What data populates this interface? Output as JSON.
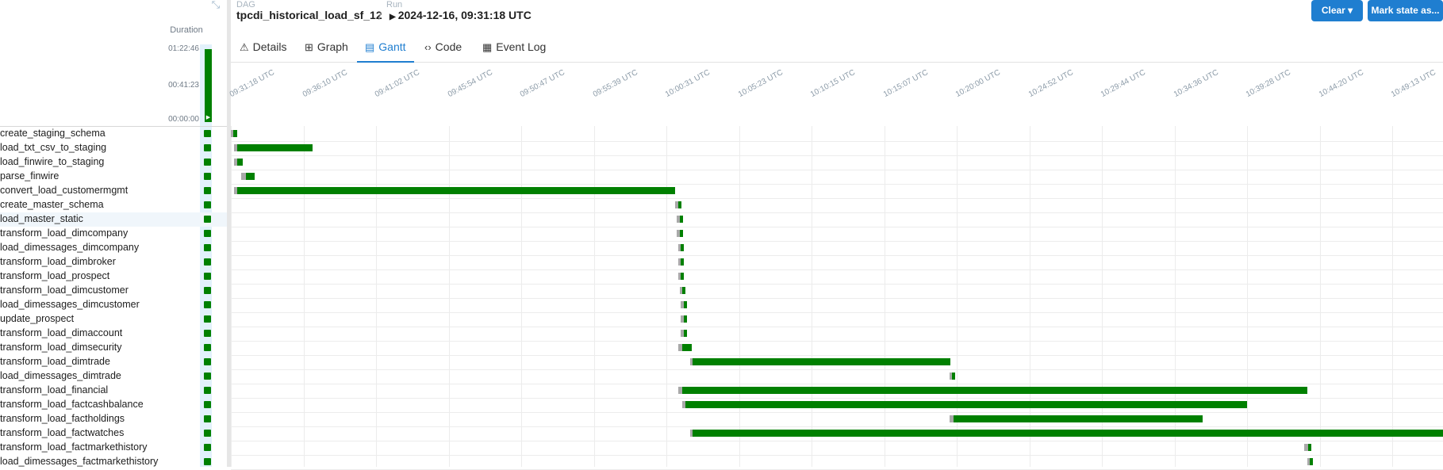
{
  "header": {
    "dag_label": "DAG",
    "dag_name": "tpcdi_historical_load_sf_12",
    "separator": "/",
    "run_label": "Run",
    "run_value": "2024-12-16, 09:31:18 UTC"
  },
  "buttons": {
    "clear": "Clear ▾",
    "mark_state": "Mark state as..."
  },
  "tabs": [
    {
      "label": "Details",
      "icon": "warning-icon",
      "glyph": "⚠"
    },
    {
      "label": "Graph",
      "icon": "graph-icon",
      "glyph": "⊞"
    },
    {
      "label": "Gantt",
      "icon": "gantt-icon",
      "glyph": "▤"
    },
    {
      "label": "Code",
      "icon": "code-icon",
      "glyph": "‹›"
    },
    {
      "label": "Event Log",
      "icon": "event-log-icon",
      "glyph": "▦"
    }
  ],
  "active_tab": "Gantt",
  "duration": {
    "label": "Duration",
    "ticks": [
      "01:22:46",
      "00:41:23",
      "00:00:00"
    ]
  },
  "status_color": "#008000",
  "queued_color": "#a9a9a9",
  "accent_color": "#1f7ed0",
  "gantt": {
    "time_ticks": [
      "09:31:18 UTC",
      "09:36:10 UTC",
      "09:41:02 UTC",
      "09:45:54 UTC",
      "09:50:47 UTC",
      "09:55:39 UTC",
      "10:00:31 UTC",
      "10:05:23 UTC",
      "10:10:15 UTC",
      "10:15:07 UTC",
      "10:20:00 UTC",
      "10:24:52 UTC",
      "10:29:44 UTC",
      "10:34:36 UTC",
      "10:39:28 UTC",
      "10:44:20 UTC",
      "10:49:13 UTC"
    ],
    "tasks": [
      {
        "name": "create_staging_schema",
        "queue_start": 0.0,
        "run_start": 0.15,
        "end": 0.4
      },
      {
        "name": "load_txt_csv_to_staging",
        "queue_start": 0.2,
        "run_start": 0.4,
        "end": 5.5
      },
      {
        "name": "load_finwire_to_staging",
        "queue_start": 0.2,
        "run_start": 0.4,
        "end": 0.8
      },
      {
        "name": "parse_finwire",
        "queue_start": 0.7,
        "run_start": 1.0,
        "end": 1.6
      },
      {
        "name": "convert_load_customermgmt",
        "queue_start": 0.2,
        "run_start": 0.4,
        "end": 29.8
      },
      {
        "name": "create_master_schema",
        "queue_start": 29.8,
        "run_start": 30.0,
        "end": 30.2
      },
      {
        "name": "load_master_static",
        "queue_start": 29.9,
        "run_start": 30.1,
        "end": 30.3
      },
      {
        "name": "transform_load_dimcompany",
        "queue_start": 29.9,
        "run_start": 30.1,
        "end": 30.3
      },
      {
        "name": "load_dimessages_dimcompany",
        "queue_start": 30.0,
        "run_start": 30.2,
        "end": 30.4
      },
      {
        "name": "transform_load_dimbroker",
        "queue_start": 30.0,
        "run_start": 30.2,
        "end": 30.4
      },
      {
        "name": "transform_load_prospect",
        "queue_start": 30.0,
        "run_start": 30.2,
        "end": 30.4
      },
      {
        "name": "transform_load_dimcustomer",
        "queue_start": 30.1,
        "run_start": 30.3,
        "end": 30.5
      },
      {
        "name": "load_dimessages_dimcustomer",
        "queue_start": 30.2,
        "run_start": 30.4,
        "end": 30.6
      },
      {
        "name": "update_prospect",
        "queue_start": 30.2,
        "run_start": 30.4,
        "end": 30.6
      },
      {
        "name": "transform_load_dimaccount",
        "queue_start": 30.2,
        "run_start": 30.4,
        "end": 30.6
      },
      {
        "name": "transform_load_dimsecurity",
        "queue_start": 30.0,
        "run_start": 30.3,
        "end": 30.9
      },
      {
        "name": "transform_load_dimtrade",
        "queue_start": 30.8,
        "run_start": 31.0,
        "end": 48.3
      },
      {
        "name": "load_dimessages_dimtrade",
        "queue_start": 48.2,
        "run_start": 48.4,
        "end": 48.6
      },
      {
        "name": "transform_load_financial",
        "queue_start": 30.0,
        "run_start": 30.3,
        "end": 72.2
      },
      {
        "name": "transform_load_factcashbalance",
        "queue_start": 30.3,
        "run_start": 30.5,
        "end": 68.2
      },
      {
        "name": "transform_load_factholdings",
        "queue_start": 48.2,
        "run_start": 48.5,
        "end": 65.2
      },
      {
        "name": "transform_load_factwatches",
        "queue_start": 30.8,
        "run_start": 31.0,
        "end": 82.0
      },
      {
        "name": "transform_load_factmarkethistory",
        "queue_start": 72.0,
        "run_start": 72.3,
        "end": 72.5
      },
      {
        "name": "load_dimessages_factmarkethistory",
        "queue_start": 72.2,
        "run_start": 72.4,
        "end": 72.6
      }
    ]
  }
}
